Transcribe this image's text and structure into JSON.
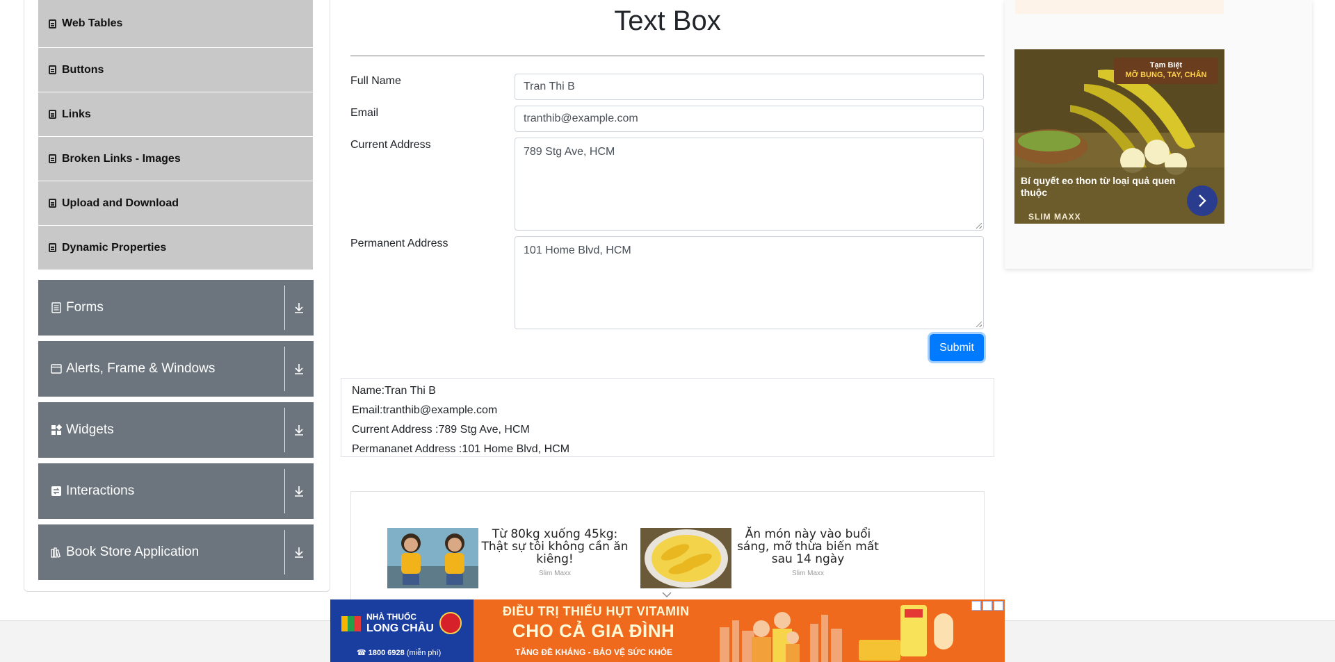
{
  "sidebar": {
    "sub_items": [
      {
        "label": "Web Tables"
      },
      {
        "label": "Buttons"
      },
      {
        "label": "Links"
      },
      {
        "label": "Broken Links - Images"
      },
      {
        "label": "Upload and Download"
      },
      {
        "label": "Dynamic Properties"
      }
    ],
    "groups": [
      {
        "label": "Forms",
        "icon": "form-icon"
      },
      {
        "label": "Alerts, Frame & Windows",
        "icon": "window-icon"
      },
      {
        "label": "Widgets",
        "icon": "widgets-icon"
      },
      {
        "label": "Interactions",
        "icon": "interactions-icon"
      },
      {
        "label": "Book Store Application",
        "icon": "book-icon"
      }
    ]
  },
  "form": {
    "title": "Text Box",
    "full_name": {
      "label": "Full Name",
      "value": "Tran Thi B"
    },
    "email": {
      "label": "Email",
      "value": "tranthib@example.com"
    },
    "current_address": {
      "label": "Current Address",
      "value": "789 Stg Ave, HCM"
    },
    "permanent_address": {
      "label": "Permanent Address",
      "value": "101 Home Blvd, HCM"
    },
    "submit_label": "Submit"
  },
  "output": {
    "name": "Name:Tran Thi B",
    "email": "Email:tranthib@example.com",
    "current_address": "Current Address :789 Stg Ave, HCM",
    "permanent_address": "Permananet Address :101 Home Blvd, HCM"
  },
  "inline_ads": [
    {
      "title": "Từ 80kg xuống 45kg: Thật sự tôi không cần ăn kiêng!",
      "source": "Slim Maxx"
    },
    {
      "title": "Ăn món này vào buổi sáng, mỡ thừa biến mất sau 14 ngày",
      "source": "Slim Maxx"
    }
  ],
  "side_ad": {
    "badge_line1": "Tạm Biệt",
    "badge_line2": "MỠ BỤNG, TAY, CHÂN",
    "headline": "Bí quyết eo thon từ loại quả quen thuộc",
    "brand": "SLIM MAXX"
  },
  "bottom_banner": {
    "store_line1": "NHÀ THUỐC",
    "store_line2": "LONG CHÂU",
    "phone": "1800 6928",
    "phone_note": "(miễn phí)",
    "headline1": "ĐIỀU TRỊ THIẾU HỤT VITAMIN",
    "headline2": "CHO CẢ GIA ĐÌNH",
    "tagline": "TĂNG ĐỀ KHÁNG - BẢO VỆ SỨC KHỎE"
  },
  "colors": {
    "group_bg": "#6c757d",
    "sub_item_bg": "#c8c8c8",
    "submit_bg": "#007bff"
  }
}
